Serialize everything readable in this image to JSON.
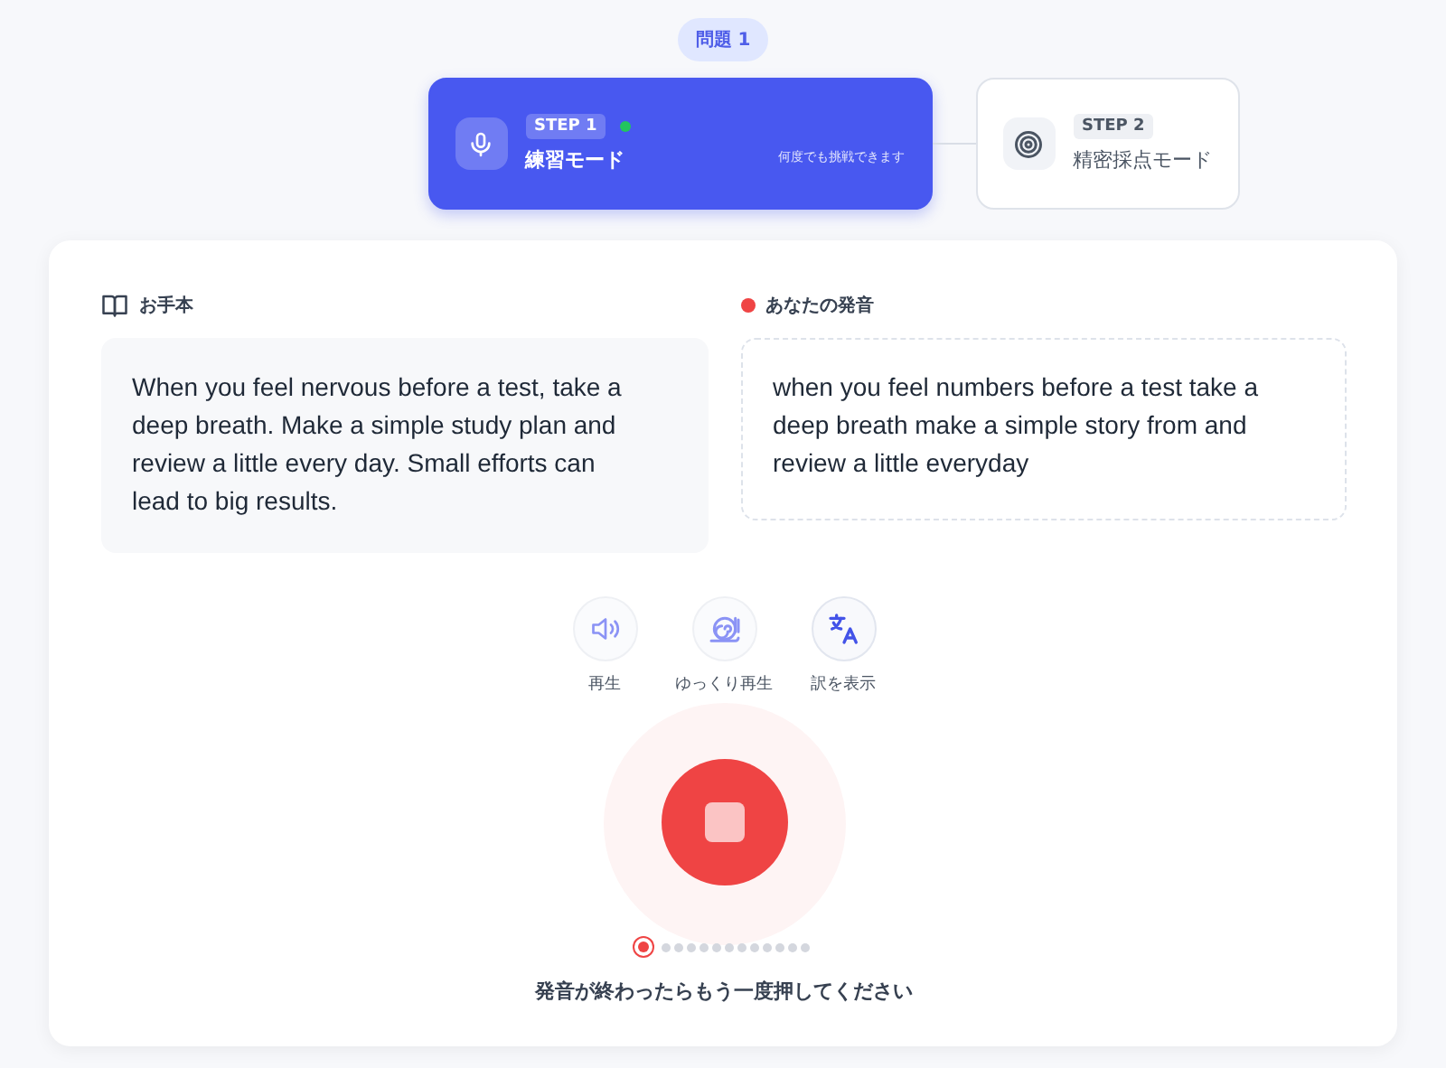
{
  "question_badge": "問題 1",
  "steps": [
    {
      "step": "STEP 1",
      "title": "練習モード",
      "note": "何度でも挑戦できます",
      "selected": true,
      "kind": "mic",
      "live": true
    },
    {
      "step": "STEP 2",
      "title": "精密採点モード",
      "selected": false,
      "kind": "target",
      "live": false
    }
  ],
  "model": {
    "label": "お手本",
    "text": "When you feel nervous before a test, take a deep breath. Make a simple study plan and review a little every day. Small efforts can lead to big results."
  },
  "yours": {
    "label": "あなたの発音",
    "text": "when you feel numbers before a test take a deep breath make a simple story from and review a little everyday"
  },
  "actions": [
    {
      "kind": "speaker",
      "label": "再生",
      "active": false
    },
    {
      "kind": "snail",
      "label": "ゆっくり再生",
      "active": false
    },
    {
      "kind": "translate",
      "label": "訳を表示",
      "active": true
    }
  ],
  "recording": true,
  "dots": [
    {
      "selected": true
    },
    {
      "selected": false
    },
    {
      "selected": false
    },
    {
      "selected": false
    },
    {
      "selected": false
    },
    {
      "selected": false
    },
    {
      "selected": false
    },
    {
      "selected": false
    },
    {
      "selected": false
    },
    {
      "selected": false
    },
    {
      "selected": false
    },
    {
      "selected": false
    },
    {
      "selected": false
    }
  ],
  "hint": "発音が終わったらもう一度押してください"
}
